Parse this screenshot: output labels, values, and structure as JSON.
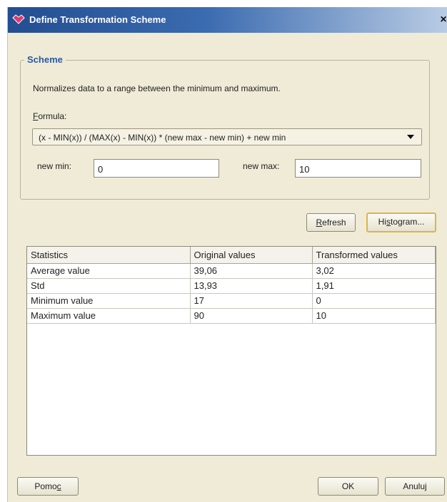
{
  "window": {
    "title": "Define Transformation Scheme",
    "close_glyph": "×"
  },
  "scheme": {
    "legend": "Scheme",
    "description": "Normalizes data to a range between the minimum and maximum.",
    "formula_label_first": "F",
    "formula_label_rest": "ormula:",
    "formula_value": "(x - MIN(x)) / (MAX(x) - MIN(x)) * (new max - new min) + new min",
    "new_min_label": "new min:",
    "new_min_value": "0",
    "new_max_label": "new max:",
    "new_max_value": "10"
  },
  "buttons": {
    "refresh_first": "R",
    "refresh_rest": "efresh",
    "histogram_pre": "Hi",
    "histogram_underlined": "s",
    "histogram_rest": "togram...",
    "help_pre": "Pomo",
    "help_underlined": "c",
    "ok": "OK",
    "cancel": "Anuluj"
  },
  "table": {
    "columns": [
      "Statistics",
      "Original values",
      "Transformed values"
    ],
    "rows": [
      [
        "Average value",
        "39,06",
        "3,02"
      ],
      [
        "Std",
        "13,93",
        "1,91"
      ],
      [
        "Minimum value",
        "17",
        "0"
      ],
      [
        "Maximum value",
        "90",
        "10"
      ]
    ]
  }
}
